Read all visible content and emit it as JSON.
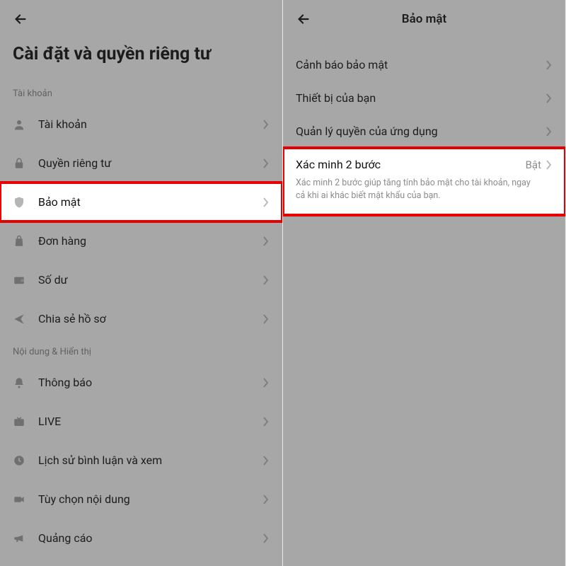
{
  "left": {
    "page_title": "Cài đặt và quyền riêng tư",
    "section1_label": "Tài khoản",
    "items1": [
      {
        "label": "Tài khoản"
      },
      {
        "label": "Quyền riêng tư"
      },
      {
        "label": "Bảo mật"
      },
      {
        "label": "Đơn hàng"
      },
      {
        "label": "Số dư"
      },
      {
        "label": "Chia sẻ hồ sơ"
      }
    ],
    "section2_label": "Nội dung & Hiển thị",
    "items2": [
      {
        "label": "Thông báo"
      },
      {
        "label": "LIVE"
      },
      {
        "label": "Lịch sử bình luận và xem"
      },
      {
        "label": "Tùy chọn nội dung"
      },
      {
        "label": "Quảng cáo"
      }
    ]
  },
  "right": {
    "header_title": "Bảo mật",
    "items": [
      {
        "title": "Cảnh báo bảo mật"
      },
      {
        "title": "Thiết bị của bạn"
      },
      {
        "title": "Quản lý quyền của ứng dụng"
      },
      {
        "title": "Xác minh 2 bước",
        "value": "Bật",
        "subtitle": "Xác minh 2 bước giúp tăng tính bảo mật cho tài khoản, ngay cả khi ai khác biết mật khẩu của bạn."
      }
    ]
  },
  "colors": {
    "highlight_border": "#e70000"
  }
}
